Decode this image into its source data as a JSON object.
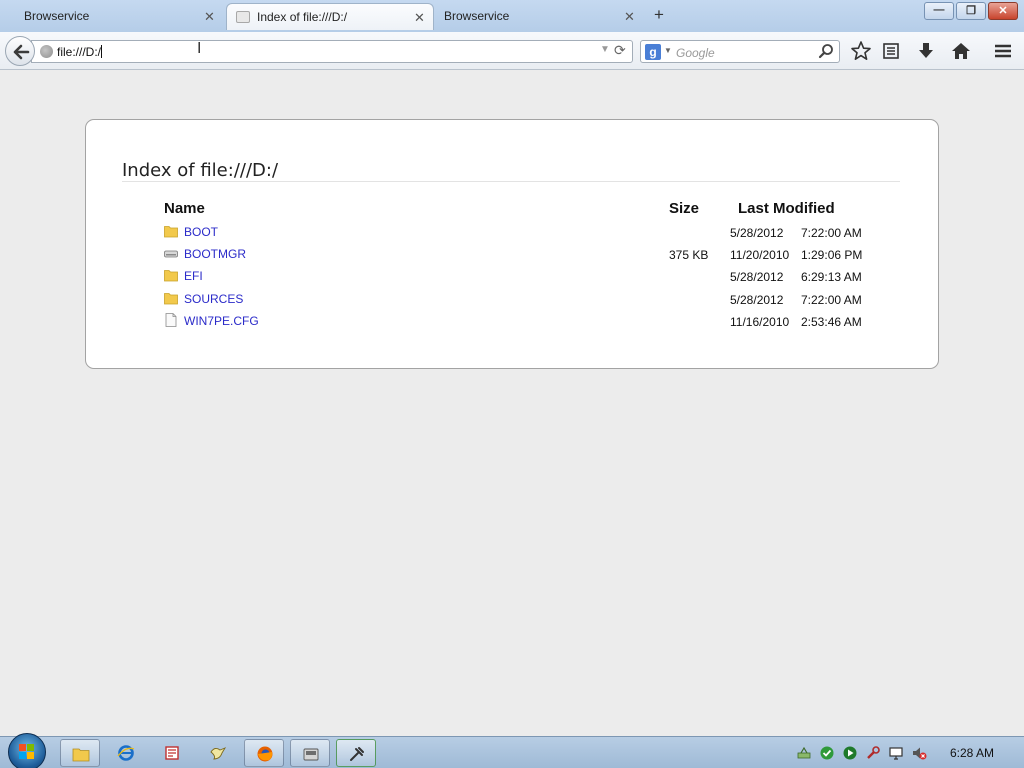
{
  "browser": {
    "tabs": [
      {
        "label": "Browservice",
        "active": false
      },
      {
        "label": "Index of file:///D:/",
        "active": true
      },
      {
        "label": "Browservice",
        "active": false
      }
    ],
    "new_tab_glyph": "+",
    "tab_close_glyph": "✕",
    "url": "file:///D:/",
    "search_placeholder": "Google",
    "search_engine_glyph": "g",
    "window_buttons": {
      "minimize": "—",
      "maximize": "❐",
      "close": "✕"
    }
  },
  "page": {
    "title": "Index of file:///D:/",
    "columns": {
      "name": "Name",
      "size": "Size",
      "modified": "Last Modified"
    },
    "files": [
      {
        "name": "BOOT",
        "type": "folder",
        "size": "",
        "date": "5/28/2012",
        "time": "7:22:00 AM"
      },
      {
        "name": "BOOTMGR",
        "type": "drive-file",
        "size": "375 KB",
        "date": "11/20/2010",
        "time": "1:29:06 PM"
      },
      {
        "name": "EFI",
        "type": "folder",
        "size": "",
        "date": "5/28/2012",
        "time": "6:29:13 AM"
      },
      {
        "name": "SOURCES",
        "type": "folder",
        "size": "",
        "date": "5/28/2012",
        "time": "7:22:00 AM"
      },
      {
        "name": "WIN7PE.CFG",
        "type": "file",
        "size": "",
        "date": "11/16/2010",
        "time": "2:53:46 AM"
      }
    ]
  },
  "taskbar": {
    "clock": "6:28 AM",
    "pinned_apps": [
      "explorer-icon",
      "internet-explorer-icon",
      "app-icon",
      "bird-icon",
      "firefox-icon",
      "disk-icon",
      "tool-icon"
    ]
  },
  "colors": {
    "link": "#2b2bc9",
    "folder": "#f2c94c",
    "page_bg": "#ececec",
    "taskbar": "#a9c3de"
  }
}
